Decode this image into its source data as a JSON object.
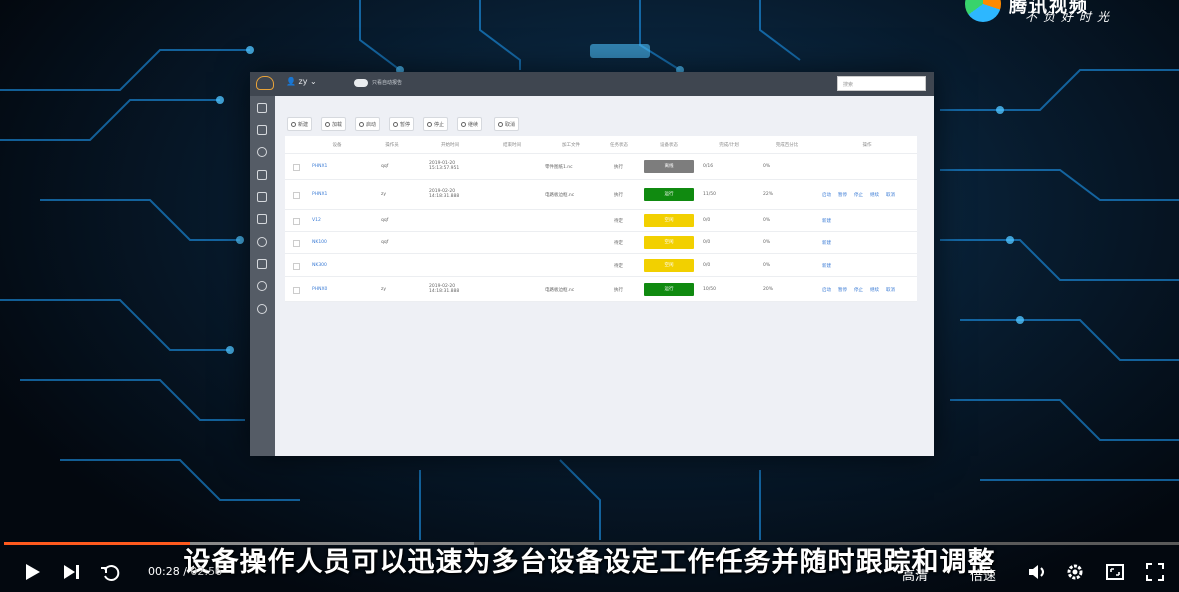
{
  "player": {
    "brand": "腾讯视频",
    "slogan": "不负好时光",
    "subtitle": "设备操作人员可以迅速为多台设备设定工作任务并随时跟踪和调整",
    "current_time": "00:28",
    "duration": "02:56",
    "progress": 0.158,
    "buffered": 0.4,
    "quality_label": "高清",
    "speed_label": "倍速",
    "accent_color": "#ff5a1e"
  },
  "app": {
    "user": "zy",
    "toggle_label": "只看自动报告",
    "search_placeholder": "搜索",
    "actions": [
      "新建",
      "加载",
      "启动",
      "暂停",
      "停止",
      "继续",
      "取消"
    ],
    "table": {
      "headers": [
        "",
        "设备",
        "操作员",
        "开始时间",
        "结束时间",
        "加工文件",
        "任务状态",
        "设备状态",
        "完成/计划",
        "完成百分比",
        "操作"
      ],
      "rows": [
        {
          "device": "PHNX1",
          "operator": "qqf",
          "start": "2019-01-20 15:13:57.951",
          "end": "",
          "file": "零件图纸1.nc",
          "task": "执行",
          "status": "离线",
          "status_color": "#7d7d7d",
          "done": "0/16",
          "pct": "0%",
          "ops": []
        },
        {
          "device": "PHNX1",
          "operator": "zy",
          "start": "2019-02-20 14:18:31.888",
          "end": "",
          "file": "电路板边框.nc",
          "task": "执行",
          "status": "运行",
          "status_color": "#108a10",
          "done": "11/50",
          "pct": "22%",
          "ops": [
            "启动",
            "暂停",
            "停止",
            "继续",
            "取消"
          ]
        },
        {
          "device": "V12",
          "operator": "qqf",
          "start": "",
          "end": "",
          "file": "",
          "task": "待定",
          "status": "空闲",
          "status_color": "#f2d000",
          "done": "0/0",
          "pct": "0%",
          "ops": [
            "新建"
          ]
        },
        {
          "device": "NK100",
          "operator": "qqf",
          "start": "",
          "end": "",
          "file": "",
          "task": "待定",
          "status": "空闲",
          "status_color": "#f2d000",
          "done": "0/0",
          "pct": "0%",
          "ops": [
            "新建"
          ]
        },
        {
          "device": "NK300",
          "operator": "",
          "start": "",
          "end": "",
          "file": "",
          "task": "待定",
          "status": "空闲",
          "status_color": "#f2d000",
          "done": "0/0",
          "pct": "0%",
          "ops": [
            "新建"
          ]
        },
        {
          "device": "PHNX0",
          "operator": "zy",
          "start": "2019-02-20 14:18:31.888",
          "end": "",
          "file": "电路板边框.nc",
          "task": "执行",
          "status": "运行",
          "status_color": "#108a10",
          "done": "10/50",
          "pct": "20%",
          "ops": [
            "启动",
            "暂停",
            "停止",
            "继续",
            "取消"
          ]
        }
      ]
    }
  }
}
